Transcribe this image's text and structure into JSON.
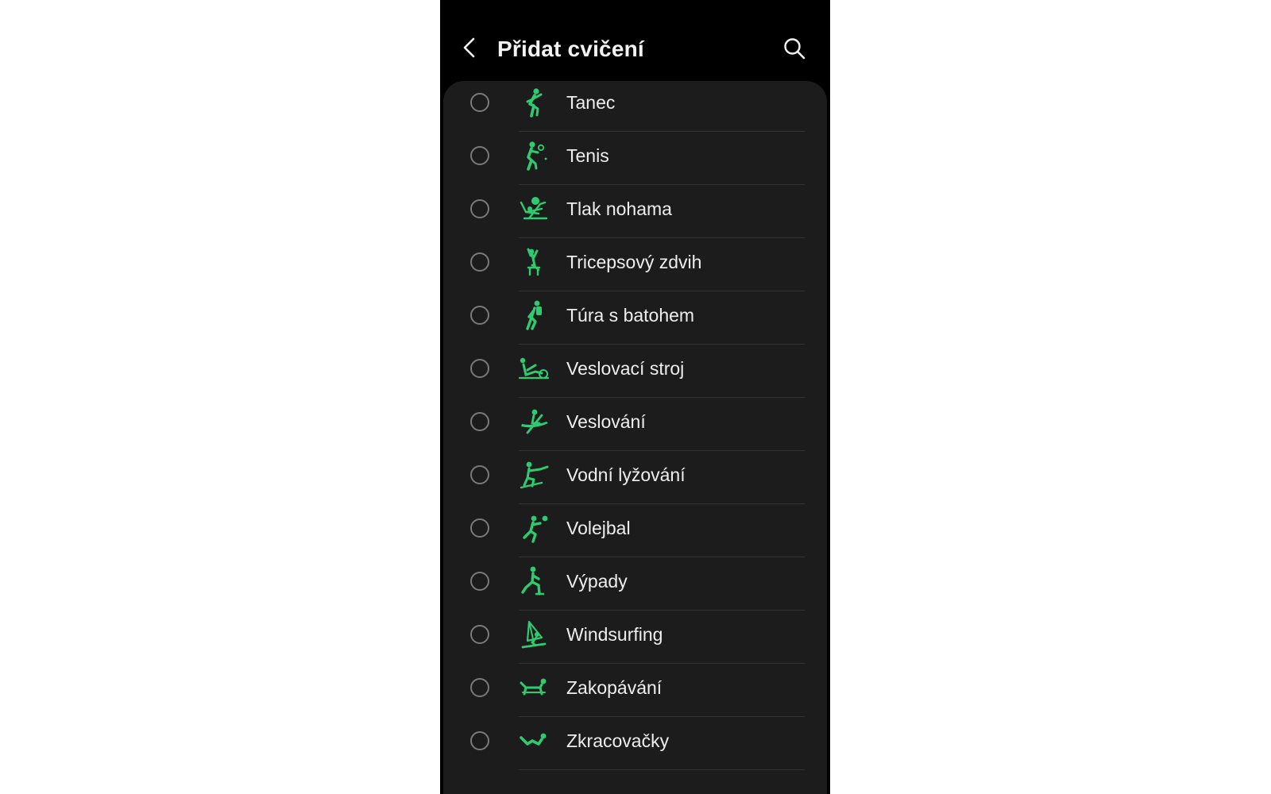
{
  "header": {
    "title": "Přidat cvičení",
    "back_icon": "back-arrow-icon",
    "search_icon": "search-icon"
  },
  "colors": {
    "accent": "#2ecc71",
    "background": "#000000",
    "list_background": "#1c1c1c",
    "text": "#eeeeee",
    "radio_border": "#7a7a7a"
  },
  "items": [
    {
      "label": "Tanec",
      "icon": "dance-icon"
    },
    {
      "label": "Tenis",
      "icon": "tennis-icon"
    },
    {
      "label": "Tlak nohama",
      "icon": "leg-press-icon"
    },
    {
      "label": "Tricepsový zdvih",
      "icon": "triceps-icon"
    },
    {
      "label": "Túra s batohem",
      "icon": "backpacking-icon"
    },
    {
      "label": "Veslovací stroj",
      "icon": "rowing-machine-icon"
    },
    {
      "label": "Veslování",
      "icon": "rowing-icon"
    },
    {
      "label": "Vodní lyžování",
      "icon": "water-skiing-icon"
    },
    {
      "label": "Volejbal",
      "icon": "volleyball-icon"
    },
    {
      "label": "Výpady",
      "icon": "lunges-icon"
    },
    {
      "label": "Windsurfing",
      "icon": "windsurfing-icon"
    },
    {
      "label": "Zakopávání",
      "icon": "butt-kicks-icon"
    },
    {
      "label": "Zkracovačky",
      "icon": "crunches-icon"
    }
  ]
}
